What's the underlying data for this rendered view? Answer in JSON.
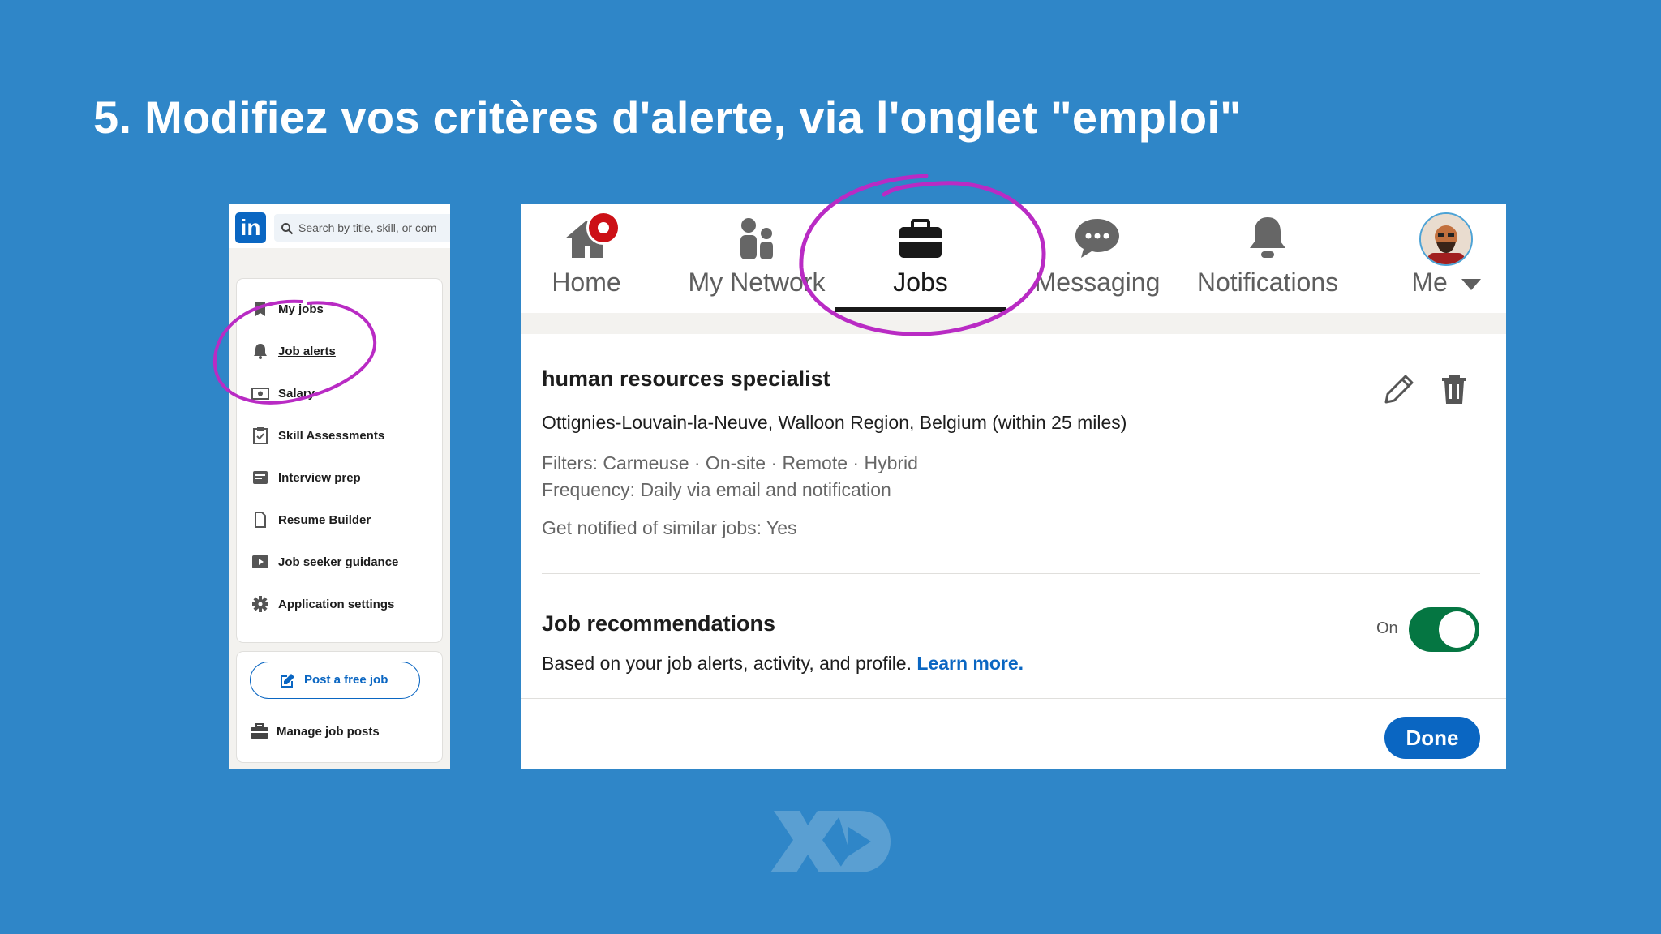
{
  "slide": {
    "title": "5. Modifiez vos critères d'alerte, via l'onglet \"emploi\""
  },
  "left_panel": {
    "logo": "in",
    "search_placeholder": "Search by title, skill, or com",
    "nav_items": [
      {
        "label": "My jobs",
        "icon": "bookmark-icon"
      },
      {
        "label": "Job alerts",
        "icon": "bell-icon"
      },
      {
        "label": "Salary",
        "icon": "money-icon"
      },
      {
        "label": "Skill Assessments",
        "icon": "clipboard-check-icon"
      },
      {
        "label": "Interview prep",
        "icon": "notes-icon"
      },
      {
        "label": "Resume Builder",
        "icon": "document-icon"
      },
      {
        "label": "Job seeker guidance",
        "icon": "play-icon"
      },
      {
        "label": "Application settings",
        "icon": "gear-icon"
      }
    ],
    "post_job_label": "Post a free job",
    "manage_posts_label": "Manage job posts"
  },
  "top_nav": {
    "items": [
      {
        "label": "Home",
        "icon": "home-icon"
      },
      {
        "label": "My Network",
        "icon": "network-icon"
      },
      {
        "label": "Jobs",
        "icon": "briefcase-icon",
        "active": true
      },
      {
        "label": "Messaging",
        "icon": "messaging-icon"
      },
      {
        "label": "Notifications",
        "icon": "bell-icon"
      },
      {
        "label": "Me",
        "icon": "avatar"
      }
    ]
  },
  "alert": {
    "title": "human resources specialist",
    "location": "Ottignies-Louvain-la-Neuve, Walloon Region, Belgium (within 25 miles)",
    "filters": "Filters: Carmeuse · On-site · Remote · Hybrid",
    "frequency": "Frequency: Daily via email and notification",
    "similar": "Get notified of similar jobs: Yes"
  },
  "recommendations": {
    "title": "Job recommendations",
    "description": "Based on your job alerts, activity, and profile.",
    "learn_more": "Learn more.",
    "toggle_label": "On",
    "toggle_on": true
  },
  "done_label": "Done",
  "colors": {
    "background": "#2f86c8",
    "linkedin_blue": "#0a66c2",
    "toggle_green": "#057642",
    "highlight_circle": "#b92bc4"
  }
}
